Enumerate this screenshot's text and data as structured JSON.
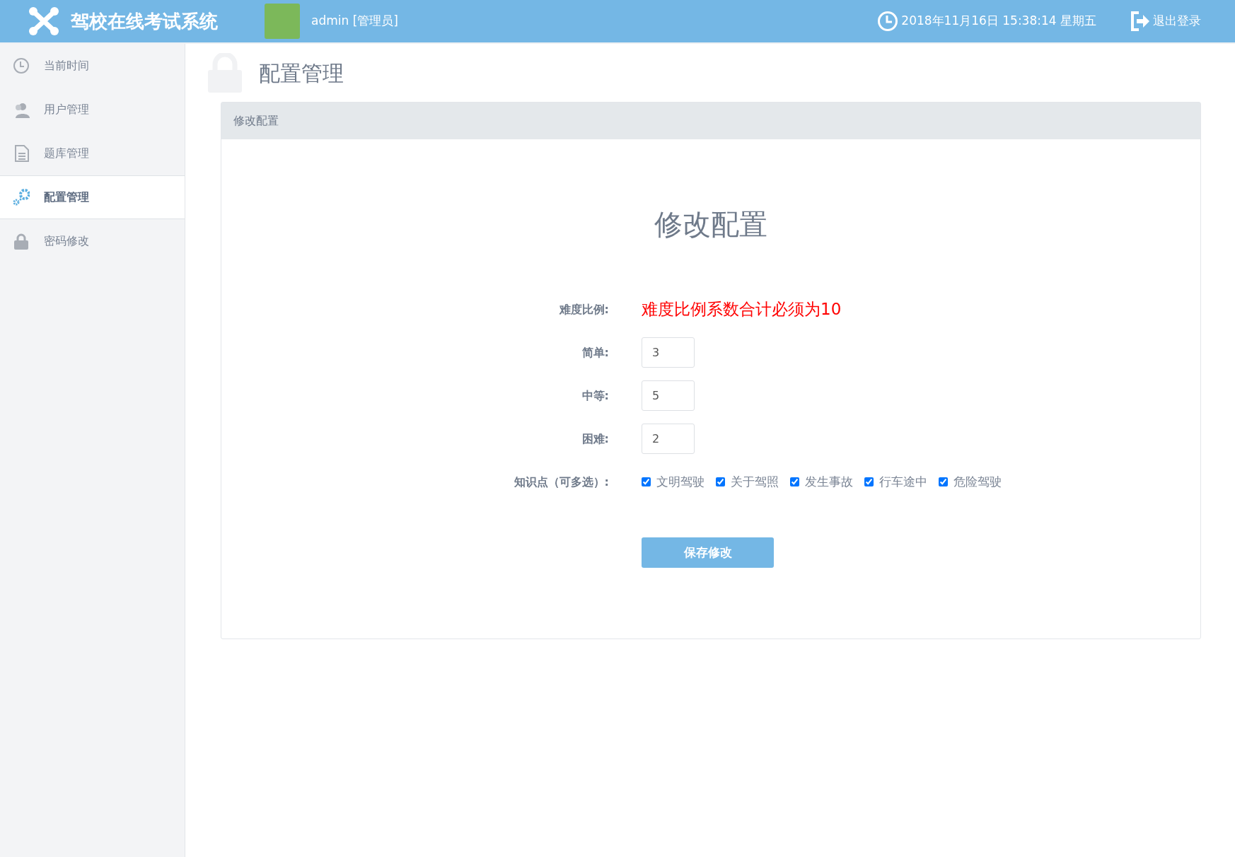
{
  "header": {
    "title": "驾校在线考试系统",
    "user": "admin [管理员]",
    "datetime": "2018年11月16日 15:38:14 星期五",
    "logout": "退出登录"
  },
  "sidebar": {
    "items": [
      {
        "label": "当前时间",
        "selected": false
      },
      {
        "label": "用户管理",
        "selected": false
      },
      {
        "label": "题库管理",
        "selected": false
      },
      {
        "label": "配置管理",
        "selected": true
      },
      {
        "label": "密码修改",
        "selected": false
      }
    ]
  },
  "page_title": "配置管理",
  "panel": {
    "heading": "修改配置",
    "form_title": "修改配置",
    "rows": [
      {
        "kind": "note",
        "label": "难度比例:",
        "text": "难度比例系数合计必须为10"
      },
      {
        "kind": "field",
        "label": "简单:",
        "value": "3"
      },
      {
        "kind": "field",
        "label": "中等:",
        "value": "5"
      },
      {
        "kind": "field",
        "label": "困难:",
        "value": "2"
      },
      {
        "kind": "checks",
        "label": "知识点（可多选）:",
        "options": [
          {
            "label": "文明驾驶",
            "checked": true
          },
          {
            "label": "关于驾照",
            "checked": true
          },
          {
            "label": "发生事故",
            "checked": true
          },
          {
            "label": "行车途中",
            "checked": true
          },
          {
            "label": "危险驾驶",
            "checked": true
          }
        ]
      }
    ],
    "button": "保存修改"
  }
}
